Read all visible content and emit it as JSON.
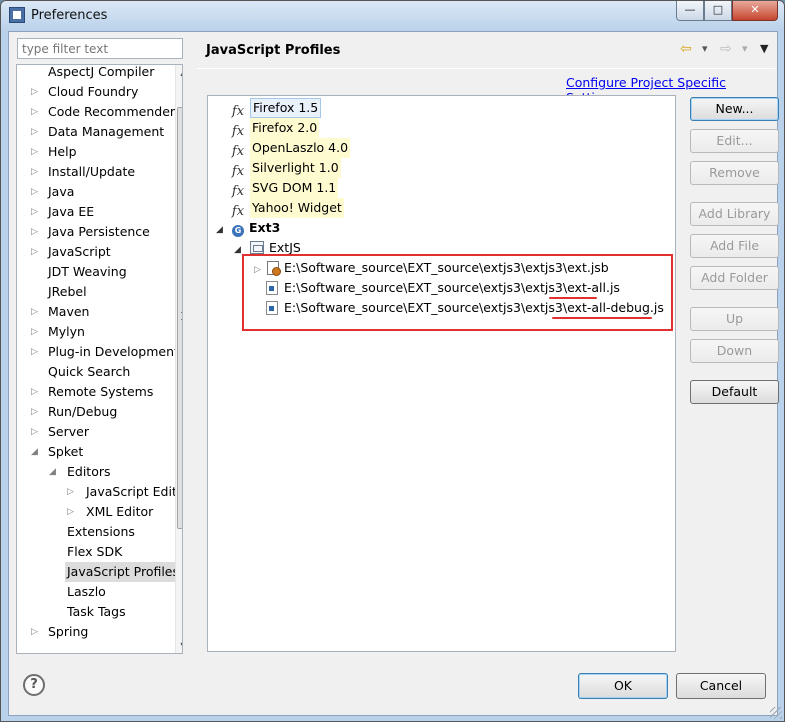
{
  "window": {
    "title": "Preferences",
    "minimize": "—",
    "maximize": "□",
    "close": "✕"
  },
  "filter": {
    "placeholder": "type filter text"
  },
  "sidebar": {
    "items": [
      {
        "label": "AspectJ Compiler",
        "arrow": ""
      },
      {
        "label": "Cloud Foundry",
        "arrow": "▷"
      },
      {
        "label": "Code Recommenders",
        "arrow": "▷"
      },
      {
        "label": "Data Management",
        "arrow": "▷"
      },
      {
        "label": "Help",
        "arrow": "▷"
      },
      {
        "label": "Install/Update",
        "arrow": "▷"
      },
      {
        "label": "Java",
        "arrow": "▷"
      },
      {
        "label": "Java EE",
        "arrow": "▷"
      },
      {
        "label": "Java Persistence",
        "arrow": "▷"
      },
      {
        "label": "JavaScript",
        "arrow": "▷"
      },
      {
        "label": "JDT Weaving",
        "arrow": ""
      },
      {
        "label": "JRebel",
        "arrow": ""
      },
      {
        "label": "Maven",
        "arrow": "▷"
      },
      {
        "label": "Mylyn",
        "arrow": "▷"
      },
      {
        "label": "Plug-in Development",
        "arrow": "▷"
      },
      {
        "label": "Quick Search",
        "arrow": ""
      },
      {
        "label": "Remote Systems",
        "arrow": "▷"
      },
      {
        "label": "Run/Debug",
        "arrow": "▷"
      },
      {
        "label": "Server",
        "arrow": "▷"
      },
      {
        "label": "Spket",
        "arrow": "◢"
      },
      {
        "label": "Editors",
        "arrow": "◢"
      },
      {
        "label": "JavaScript Editor",
        "arrow": "▷"
      },
      {
        "label": "XML Editor",
        "arrow": "▷"
      },
      {
        "label": "Extensions",
        "arrow": ""
      },
      {
        "label": "Flex SDK",
        "arrow": ""
      },
      {
        "label": "JavaScript Profiles",
        "arrow": ""
      },
      {
        "label": "Laszlo",
        "arrow": ""
      },
      {
        "label": "Task Tags",
        "arrow": ""
      },
      {
        "label": "Spring",
        "arrow": "▷"
      }
    ],
    "scroll_up": "▲",
    "scroll_down": "▼",
    "scroll_left": "◀",
    "scroll_right": "▶"
  },
  "page": {
    "title": "JavaScript Profiles",
    "nav_back": "⇦",
    "nav_back_menu": "▾",
    "nav_forward": "⇨",
    "nav_forward_menu": "▾",
    "nav_menu": "▼",
    "link": "Configure Project Specific Settings..."
  },
  "profiles": {
    "fx_glyph": "fx",
    "items": [
      "Firefox 1.5",
      "Firefox 2.0",
      "OpenLaszlo 4.0",
      "Silverlight 1.0",
      "SVG DOM 1.1",
      "Yahoo! Widget"
    ],
    "project": {
      "arrow": "◢",
      "label": "Ext3",
      "icon_glyph": "G"
    },
    "library": {
      "arrow": "◢",
      "label": "ExtJS"
    },
    "files": [
      {
        "arrow": "▷",
        "path": "E:\\Software_source\\EXT_source\\extjs3\\extjs3\\ext.jsb"
      },
      {
        "arrow": "",
        "path": "E:\\Software_source\\EXT_source\\extjs3\\extjs3\\ext-all.js"
      },
      {
        "arrow": "",
        "path": "E:\\Software_source\\EXT_source\\extjs3\\extjs3\\ext-all-debug.js"
      }
    ]
  },
  "buttons": {
    "new": "New...",
    "edit": "Edit...",
    "remove": "Remove",
    "add_library": "Add Library",
    "add_file": "Add File",
    "add_folder": "Add Folder",
    "up": "Up",
    "down": "Down",
    "default": "Default"
  },
  "footer": {
    "help": "?",
    "ok": "OK",
    "cancel": "Cancel"
  },
  "colors": {
    "annotation": "#e03030",
    "link": "#0000ee",
    "selection": "#e9f1fb",
    "profile_highlight": "#fffbd0"
  }
}
